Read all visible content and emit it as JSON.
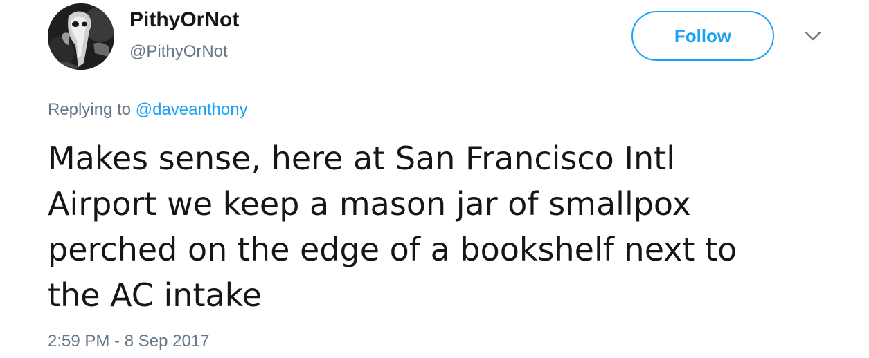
{
  "author": {
    "display_name": "PithyOrNot",
    "handle": "@PithyOrNot",
    "avatar_icon": "plague-doctor-avatar"
  },
  "actions": {
    "follow_label": "Follow",
    "more_icon": "chevron-down-icon"
  },
  "reply": {
    "prefix": "Replying to",
    "mention": "@daveanthony"
  },
  "tweet": {
    "lines": [
      "Makes sense, here at San Francisco Intl",
      "Airport we keep a mason jar of smallpox",
      "perched on the edge of a bookshelf next to",
      "the AC intake"
    ]
  },
  "timestamp": "2:59 PM - 8 Sep 2017",
  "colors": {
    "accent": "#1da1f2",
    "secondary_text": "#657786",
    "primary_text": "#14171a"
  }
}
